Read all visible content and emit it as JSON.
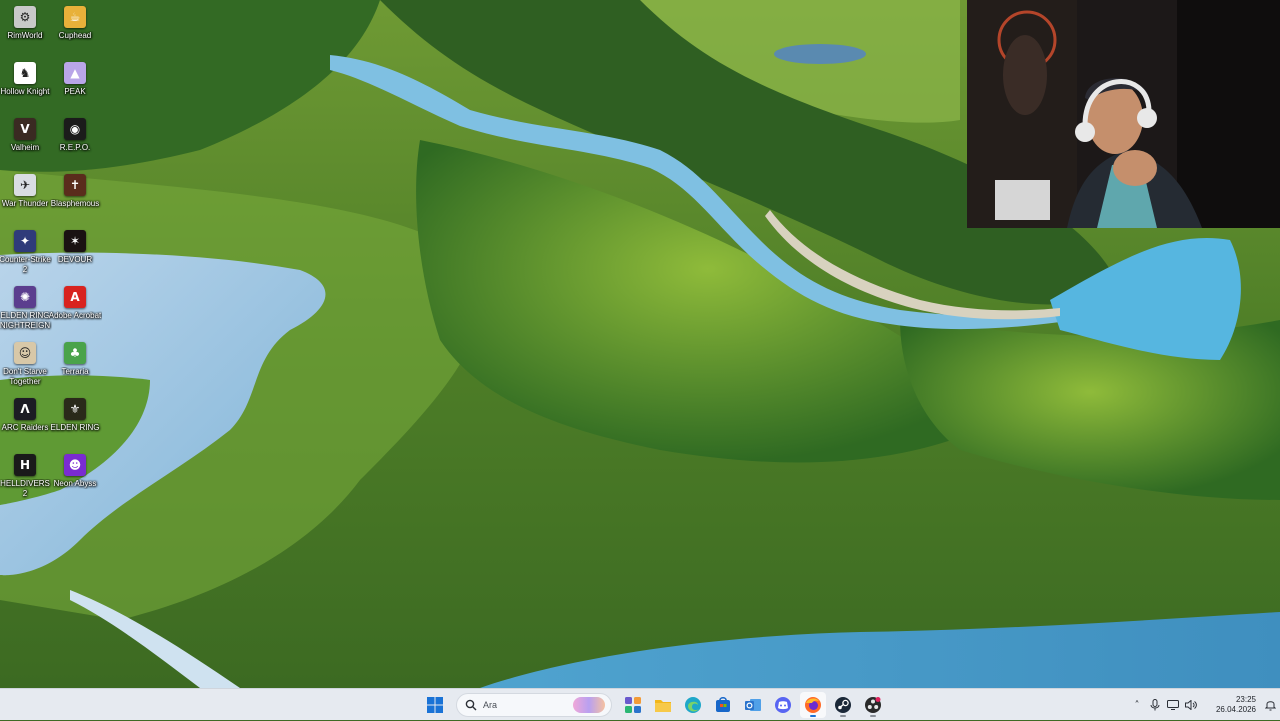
{
  "desktop": {
    "icons": [
      {
        "label": "RimWorld",
        "icon": "rimworld-icon",
        "bg": "#c9c9c9",
        "glyph": "⚙"
      },
      {
        "label": "Cuphead",
        "icon": "cuphead-icon",
        "bg": "#e8b13a",
        "glyph": "☕"
      },
      {
        "label": "Hollow Knight",
        "icon": "hollow-knight-icon",
        "bg": "#ffffff",
        "glyph": "♞"
      },
      {
        "label": "PEAK",
        "icon": "peak-icon",
        "bg": "#b9a6e8",
        "glyph": "▲"
      },
      {
        "label": "Valheim",
        "icon": "valheim-icon",
        "bg": "#3a2a22",
        "glyph": "V"
      },
      {
        "label": "R.E.P.O.",
        "icon": "repo-icon",
        "bg": "#1b1b1b",
        "glyph": "◉"
      },
      {
        "label": "War Thunder",
        "icon": "war-thunder-icon",
        "bg": "#d9dde2",
        "glyph": "✈"
      },
      {
        "label": "Blasphemous",
        "icon": "blasphemous-icon",
        "bg": "#5a2c1c",
        "glyph": "✝"
      },
      {
        "label": "Counter-Strike 2",
        "icon": "counter-strike-icon",
        "bg": "#2f3b7a",
        "glyph": "✦"
      },
      {
        "label": "DEVOUR",
        "icon": "devour-icon",
        "bg": "#1a1212",
        "glyph": "✶"
      },
      {
        "label": "ELDEN RING NIGHTREIGN",
        "icon": "nightreign-icon",
        "bg": "#5b3e8e",
        "glyph": "✺"
      },
      {
        "label": "Adobe Acrobat",
        "icon": "adobe-acrobat-icon",
        "bg": "#d8231f",
        "glyph": "A"
      },
      {
        "label": "Don't Starve Together",
        "icon": "dont-starve-icon",
        "bg": "#d8c8a8",
        "glyph": "☺"
      },
      {
        "label": "Terraria",
        "icon": "terraria-icon",
        "bg": "#4aa34a",
        "glyph": "♣"
      },
      {
        "label": "ARC Raiders",
        "icon": "arc-raiders-icon",
        "bg": "#1c1c24",
        "glyph": "Λ"
      },
      {
        "label": "ELDEN RING",
        "icon": "elden-ring-icon",
        "bg": "#2a2a1a",
        "glyph": "⚜"
      },
      {
        "label": "HELLDIVERS 2",
        "icon": "helldivers-icon",
        "bg": "#1a1a1a",
        "glyph": "H"
      },
      {
        "label": "Neon Abyss",
        "icon": "neon-abyss-icon",
        "bg": "#7a2bd1",
        "glyph": "☻"
      }
    ]
  },
  "taskbar": {
    "search_placeholder": "Ara",
    "apps": [
      {
        "name": "start-button",
        "icon": "windows-logo-icon",
        "color": "#1a73d6"
      },
      {
        "name": "search-box"
      },
      {
        "name": "widgets-button",
        "icon": "widgets-icon",
        "color": "#6a5acd"
      },
      {
        "name": "file-explorer-button",
        "icon": "folder-icon",
        "color": "#f2b71a"
      },
      {
        "name": "edge-button",
        "icon": "edge-icon",
        "color": "#1fa7c9"
      },
      {
        "name": "store-button",
        "icon": "store-icon",
        "color": "#1767c9"
      },
      {
        "name": "outlook-button",
        "icon": "outlook-icon",
        "color": "#2a73cc"
      },
      {
        "name": "discord-button",
        "icon": "discord-icon",
        "color": "#5865f2"
      },
      {
        "name": "firefox-button",
        "icon": "firefox-icon",
        "color": "#ff6a28",
        "active": true
      },
      {
        "name": "steam-button",
        "icon": "steam-icon",
        "color": "#1b2838"
      },
      {
        "name": "obs-button",
        "icon": "obs-icon",
        "color": "#2a2a2a"
      }
    ],
    "clock": {
      "time": "23:25",
      "date": "26.04.2026"
    }
  },
  "colors": {
    "taskbar_bg": "#e6eaf0",
    "accent": "#1a73d6"
  }
}
